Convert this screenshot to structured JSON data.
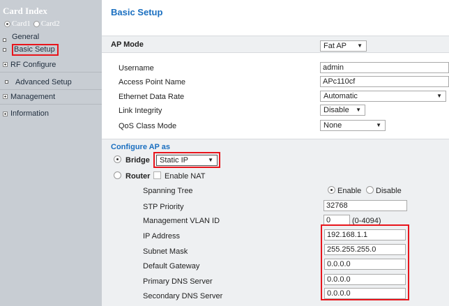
{
  "sidebar": {
    "title": "Card Index",
    "card1": "Card1",
    "card2": "Card2",
    "general": "General",
    "basic_setup": "Basic Setup",
    "rf_configure": "RF Configure",
    "advanced_setup": "Advanced Setup",
    "management": "Management",
    "information": "Information"
  },
  "page": {
    "title": "Basic Setup",
    "ap_mode_label": "AP Mode",
    "ap_mode_value": "Fat AP"
  },
  "basic": {
    "username_label": "Username",
    "username_value": "admin",
    "ap_name_label": "Access Point Name",
    "ap_name_value": "APc110cf",
    "eth_rate_label": "Ethernet Data Rate",
    "eth_rate_value": "Automatic",
    "link_label": "Link Integrity",
    "link_value": "Disable",
    "qos_label": "QoS Class Mode",
    "qos_value": "None"
  },
  "configure": {
    "title": "Configure AP as",
    "bridge_label": "Bridge",
    "bridge_mode_value": "Static IP",
    "router_label": "Router",
    "enable_nat_label": "Enable NAT",
    "spanning_tree_label": "Spanning Tree",
    "enable_label": "Enable",
    "disable_label": "Disable",
    "stp_priority_label": "STP Priority",
    "stp_priority_value": "32768",
    "vlan_label": "Management VLAN ID",
    "vlan_value": "0",
    "vlan_range": "(0-4094)",
    "ip_label": "IP Address",
    "ip_value": "192.168.1.1",
    "mask_label": "Subnet Mask",
    "mask_value": "255.255.255.0",
    "gateway_label": "Default Gateway",
    "gateway_value": "0.0.0.0",
    "dns1_label": "Primary DNS Server",
    "dns1_value": "0.0.0.0",
    "dns2_label": "Secondary DNS Server",
    "dns2_value": "0.0.0.0"
  },
  "colors": {
    "accent": "#1a6fc0",
    "highlight": "#e8141b",
    "sidebar_bg": "#c8cdd3"
  }
}
